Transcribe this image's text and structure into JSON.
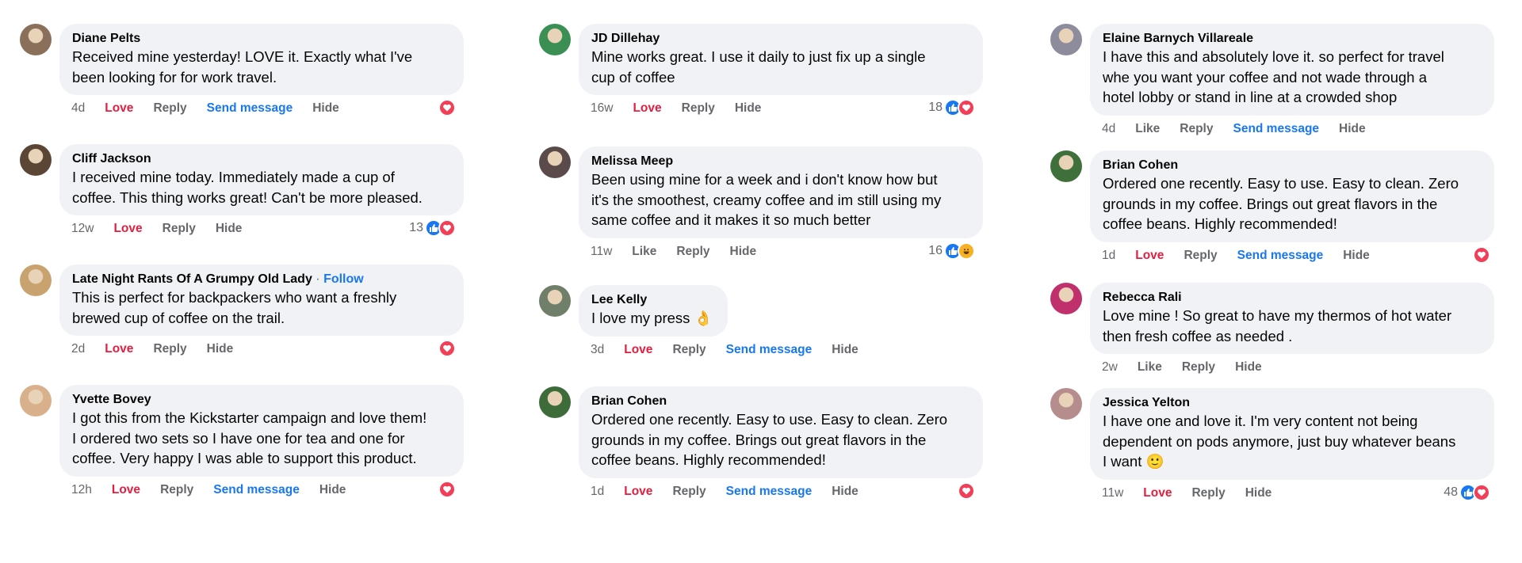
{
  "columns": [
    {
      "comments": [
        {
          "name": "Diane Pelts",
          "text_lines": [
            "Received mine yesterday! LOVE it. Exactly what I've",
            "been looking for for work travel."
          ],
          "time": "4d",
          "love": "Love",
          "reply": "Reply",
          "send": "Send message",
          "hide": "Hide",
          "reactions": {
            "count": "",
            "icons": [
              "heart"
            ]
          }
        },
        {
          "name": "Cliff Jackson",
          "text_lines": [
            "I received mine today. Immediately made a cup of",
            "coffee. This thing works great! Can't be more pleased."
          ],
          "time": "12w",
          "love": "Love",
          "reply": "Reply",
          "hide": "Hide",
          "reactions": {
            "count": "13",
            "icons": [
              "like",
              "heart"
            ]
          }
        },
        {
          "name": "Late Night Rants Of A Grumpy Old Lady",
          "follow": "Follow",
          "sep": "·",
          "text_lines": [
            "This is perfect for backpackers who want a freshly",
            "brewed cup of coffee on the trail."
          ],
          "time": "2d",
          "love": "Love",
          "reply": "Reply",
          "hide": "Hide",
          "reactions": {
            "count": "",
            "icons": [
              "heart"
            ]
          }
        },
        {
          "name": "Yvette Bovey",
          "text_lines": [
            "I got this from the Kickstarter campaign and love them!",
            "I ordered two sets so I have one for tea and one for",
            "coffee. Very happy I was able to support this product."
          ],
          "time": "12h",
          "love": "Love",
          "reply": "Reply",
          "send": "Send message",
          "hide": "Hide",
          "reactions": {
            "count": "",
            "icons": [
              "heart"
            ]
          }
        }
      ]
    },
    {
      "comments": [
        {
          "name": "JD Dillehay",
          "text_lines": [
            "Mine works great. I use it daily to just fix up a single",
            "cup of coffee"
          ],
          "time": "16w",
          "love": "Love",
          "reply": "Reply",
          "hide": "Hide",
          "reactions": {
            "count": "18",
            "icons": [
              "like",
              "heart"
            ]
          }
        },
        {
          "name": "Melissa Meep",
          "text_lines": [
            "Been using mine for a week and i don't know how but",
            "it's the smoothest, creamy coffee and im still using my",
            "same coffee and it makes it so much better"
          ],
          "time": "11w",
          "like": "Like",
          "reply": "Reply",
          "hide": "Hide",
          "reactions": {
            "count": "16",
            "icons": [
              "like",
              "haha"
            ]
          }
        },
        {
          "name": "Lee Kelly",
          "text_lines": [
            "I love my press 👌"
          ],
          "time": "3d",
          "love": "Love",
          "reply": "Reply",
          "send": "Send message",
          "hide": "Hide",
          "reactions": {
            "count": "",
            "icons": []
          }
        },
        {
          "name": "Brian Cohen",
          "text_lines": [
            "Ordered one recently. Easy to use. Easy to clean. Zero",
            "grounds in my coffee. Brings out great flavors in the",
            "coffee beans. Highly recommended!"
          ],
          "time": "1d",
          "love": "Love",
          "reply": "Reply",
          "send": "Send message",
          "hide": "Hide",
          "reactions": {
            "count": "",
            "icons": [
              "heart"
            ]
          }
        }
      ]
    },
    {
      "comments": [
        {
          "name": "Elaine Barnych Villareale",
          "text_lines": [
            "I have this and absolutely love it. so perfect for travel",
            "whe you want your coffee and not wade through a",
            "hotel lobby or stand in line at a crowded shop"
          ],
          "time": "4d",
          "like": "Like",
          "reply": "Reply",
          "send": "Send message",
          "hide": "Hide",
          "reactions": {
            "count": "",
            "icons": []
          }
        },
        {
          "name": "Brian Cohen",
          "text_lines": [
            "Ordered one recently. Easy to use. Easy to clean. Zero",
            "grounds in my coffee. Brings out great flavors in the",
            "coffee beans. Highly recommended!"
          ],
          "time": "1d",
          "love": "Love",
          "reply": "Reply",
          "send": "Send message",
          "hide": "Hide",
          "reactions": {
            "count": "",
            "icons": [
              "heart"
            ]
          }
        },
        {
          "name": "Rebecca Rali",
          "text_lines": [
            "Love mine ! So great to have my thermos of hot water",
            "then fresh coffee as needed ."
          ],
          "time": "2w",
          "like": "Like",
          "reply": "Reply",
          "hide": "Hide",
          "reactions": {
            "count": "",
            "icons": []
          }
        },
        {
          "name": "Jessica Yelton",
          "text_lines": [
            "I have one and love it. I'm very content not being",
            "dependent on pods anymore, just buy whatever beans",
            "I want 🙂"
          ],
          "time": "11w",
          "love": "Love",
          "reply": "Reply",
          "hide": "Hide",
          "reactions": {
            "count": "48",
            "icons": [
              "like",
              "heart"
            ]
          }
        }
      ]
    }
  ],
  "colors": {
    "bubble": "#f0f2f5",
    "love": "#e41e3f",
    "link": "#1877f2",
    "meta": "#65676b",
    "heart": "#f33e58",
    "like": "#1877f2"
  }
}
